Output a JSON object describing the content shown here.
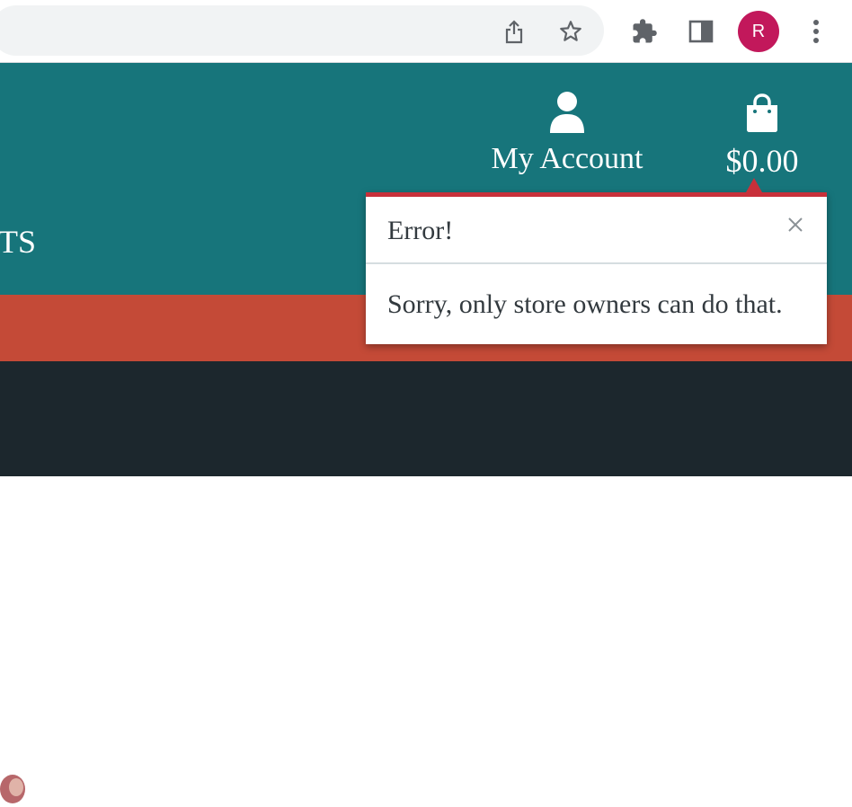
{
  "browser": {
    "profile_initial": "R",
    "avatar_color": "#c2185b",
    "icons": [
      "share-icon",
      "star-icon",
      "extensions-icon",
      "side-panel-icon",
      "menu-icon"
    ]
  },
  "header": {
    "nav_partial": "TS",
    "account_label": "My Account",
    "cart_total": "$0.00",
    "colors": {
      "header": "#17757b",
      "band": "#c44a37",
      "hero": "#1c272d"
    }
  },
  "popup": {
    "title": "Error!",
    "message": "Sorry, only store owners can do that.",
    "accent_color": "#c8303a"
  }
}
